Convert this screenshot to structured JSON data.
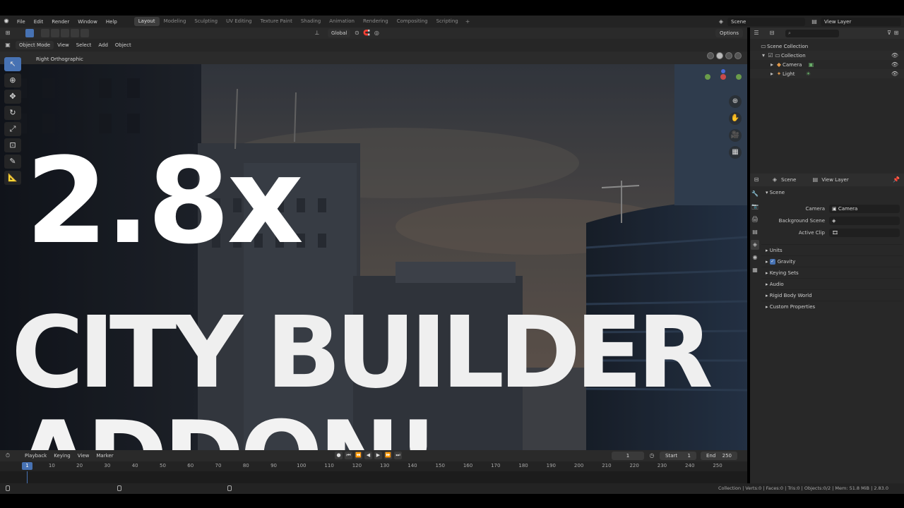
{
  "menubar": {
    "items": [
      "File",
      "Edit",
      "Render",
      "Window",
      "Help"
    ],
    "workspaces": [
      "Layout",
      "Modeling",
      "Sculpting",
      "UV Editing",
      "Texture Paint",
      "Shading",
      "Animation",
      "Rendering",
      "Compositing",
      "Scripting"
    ],
    "active_workspace": "Layout",
    "scene": "Scene",
    "view_layer": "View Layer"
  },
  "viewport": {
    "mode": "Object Mode",
    "menu": [
      "View",
      "Select",
      "Add",
      "Object"
    ],
    "transform_orientation": "Global",
    "options_label": "Options",
    "view_label": "Right Orthographic"
  },
  "title_overlay": {
    "line1": "2.8x",
    "line2": "CITY BUILDER",
    "line3": "ADDON!"
  },
  "timeline": {
    "menu": [
      "Playback",
      "Keying",
      "View",
      "Marker"
    ],
    "current_frame": "1",
    "start_label": "Start",
    "start_value": "1",
    "end_label": "End",
    "end_value": "250",
    "ticks": [
      "1",
      "10",
      "20",
      "30",
      "40",
      "50",
      "60",
      "70",
      "80",
      "90",
      "100",
      "110",
      "120",
      "130",
      "140",
      "150",
      "160",
      "170",
      "180",
      "190",
      "200",
      "210",
      "220",
      "230",
      "240",
      "250"
    ]
  },
  "statusbar": {
    "text": "Collection | Verts:0 | Faces:0 | Tris:0 | Objects:0/2 | Mem: 51.8 MiB | 2.83.0"
  },
  "outliner": {
    "rows": [
      {
        "label": "Scene Collection"
      },
      {
        "label": "Collection"
      },
      {
        "label": "Camera"
      },
      {
        "label": "Light"
      }
    ]
  },
  "properties": {
    "header_scene": "Scene",
    "header_view_layer": "View Layer",
    "panel_title": "Scene",
    "camera_label": "Camera",
    "camera_value": "Camera",
    "background_scene_label": "Background Scene",
    "active_clip_label": "Active Clip",
    "sub_panels": [
      "Units",
      "Gravity",
      "Keying Sets",
      "Audio",
      "Rigid Body World",
      "Custom Properties"
    ]
  },
  "colors": {
    "accent": "#4772b3",
    "ui_bg": "#282828",
    "title_text": "#ffffff"
  }
}
